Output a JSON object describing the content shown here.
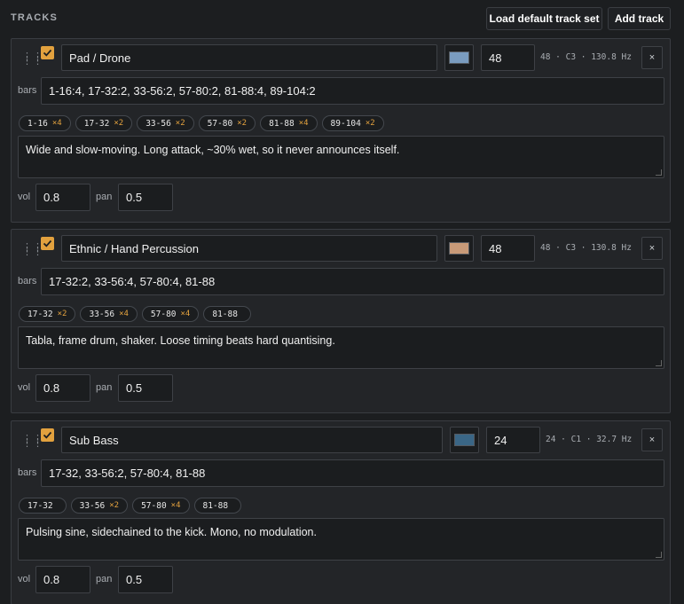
{
  "header": {
    "section_title": "TRACKS",
    "load_default_label": "Load default track set",
    "add_track_label": "Add track"
  },
  "labels": {
    "bars": "bars",
    "vol": "vol",
    "pan": "pan",
    "close": "×"
  },
  "tracks": [
    {
      "enabled": true,
      "name": "Pad / Drone",
      "color": "#7a9cc0",
      "midi": "48",
      "note_readout": "48 · C3 · 130.8 Hz",
      "bars": "1-16:4, 17-32:2, 33-56:2, 57-80:2, 81-88:4, 89-104:2",
      "chips": [
        {
          "range": "1-16",
          "mult": "×4"
        },
        {
          "range": "17-32",
          "mult": "×2"
        },
        {
          "range": "33-56",
          "mult": "×2"
        },
        {
          "range": "57-80",
          "mult": "×2"
        },
        {
          "range": "81-88",
          "mult": "×4"
        },
        {
          "range": "89-104",
          "mult": "×2"
        }
      ],
      "notes": "Wide and slow-moving. Long attack, ~30% wet, so it never announces itself.",
      "vol": "0.8",
      "pan": "0.5"
    },
    {
      "enabled": true,
      "name": "Ethnic / Hand Percussion",
      "color": "#c89a78",
      "midi": "48",
      "note_readout": "48 · C3 · 130.8 Hz",
      "bars": "17-32:2, 33-56:4, 57-80:4, 81-88",
      "chips": [
        {
          "range": "17-32",
          "mult": "×2"
        },
        {
          "range": "33-56",
          "mult": "×4"
        },
        {
          "range": "57-80",
          "mult": "×4"
        },
        {
          "range": "81-88",
          "mult": ""
        }
      ],
      "notes": "Tabla, frame drum, shaker. Loose timing beats hard quantising.",
      "vol": "0.8",
      "pan": "0.5"
    },
    {
      "enabled": true,
      "name": "Sub Bass",
      "color": "#3a6686",
      "midi": "24",
      "note_readout": "24 · C1 · 32.7 Hz",
      "bars": "17-32, 33-56:2, 57-80:4, 81-88",
      "chips": [
        {
          "range": "17-32",
          "mult": ""
        },
        {
          "range": "33-56",
          "mult": "×2"
        },
        {
          "range": "57-80",
          "mult": "×4"
        },
        {
          "range": "81-88",
          "mult": ""
        }
      ],
      "notes": "Pulsing sine, sidechained to the kick. Mono, no modulation.",
      "vol": "0.8",
      "pan": "0.5"
    }
  ]
}
